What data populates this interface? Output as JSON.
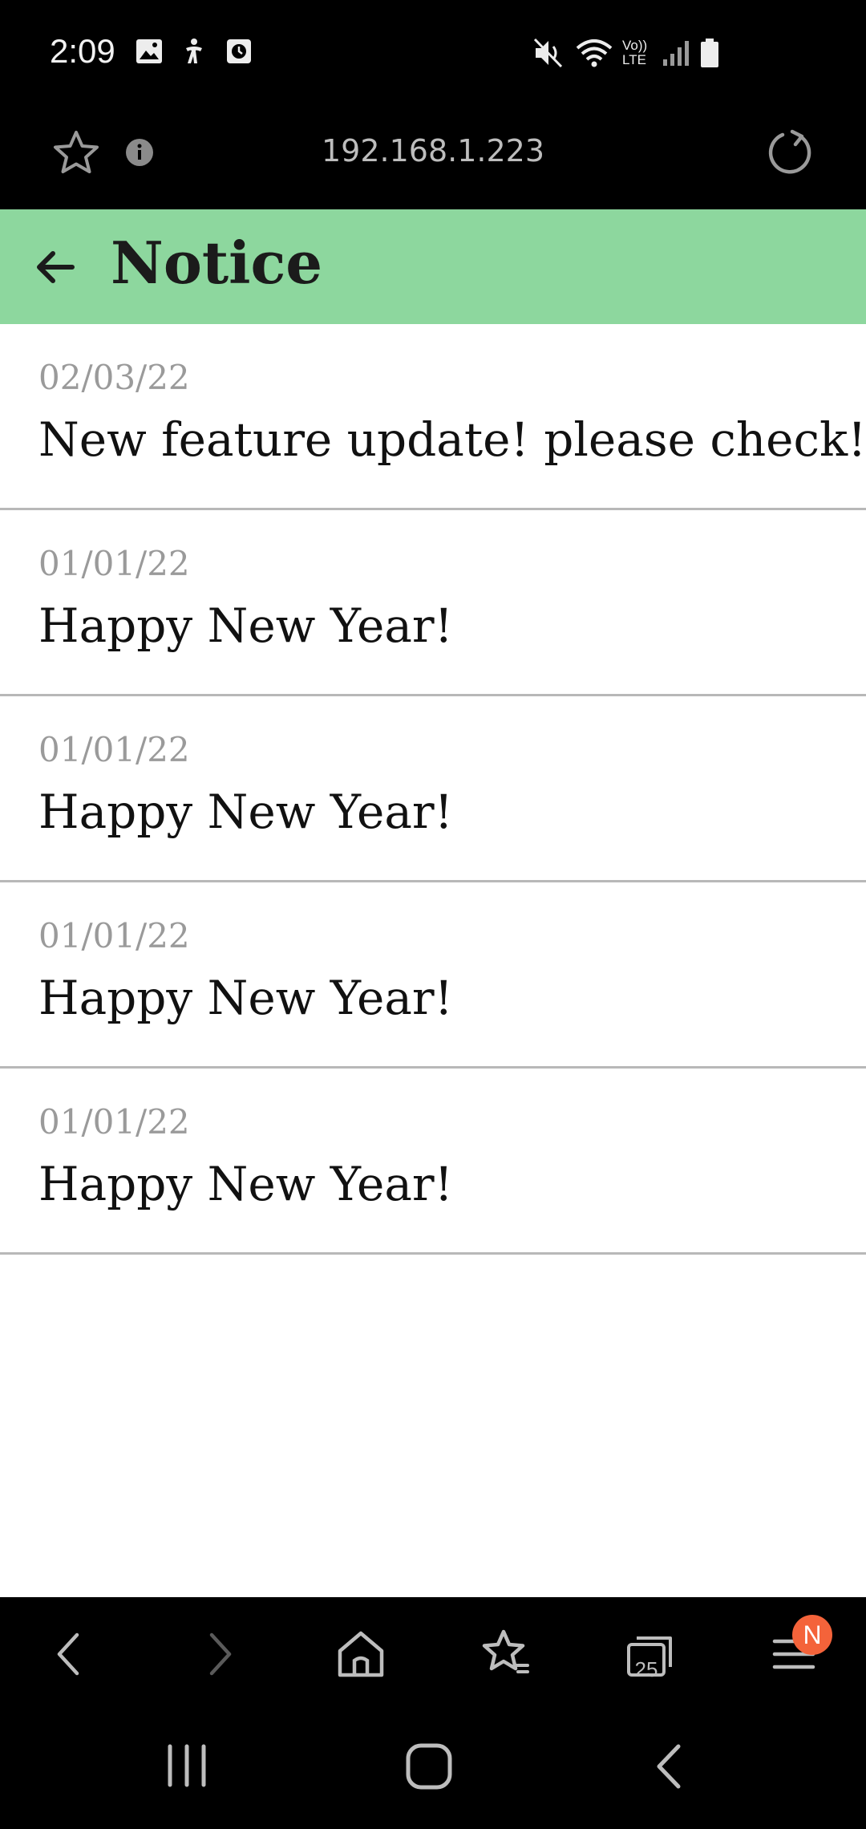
{
  "status_bar": {
    "time": "2:09",
    "left_icons": [
      "image-icon",
      "accessibility-icon",
      "clock-icon"
    ],
    "right_icons": [
      "mute-icon",
      "wifi-icon",
      "volte-icon",
      "signal-icon",
      "battery-icon"
    ],
    "volte_text": "Vo)) LTE"
  },
  "browser": {
    "url": "192.168.1.223",
    "bookmark_icon": "star-icon",
    "info_icon": "info-icon",
    "reload_icon": "reload-icon"
  },
  "header": {
    "title": "Notice",
    "back_icon": "back-arrow-icon",
    "background": "#8dd79e"
  },
  "notices": [
    {
      "date": "02/03/22",
      "title": "New feature update! please check!"
    },
    {
      "date": "01/01/22",
      "title": "Happy New Year!"
    },
    {
      "date": "01/01/22",
      "title": "Happy New Year!"
    },
    {
      "date": "01/01/22",
      "title": "Happy New Year!"
    },
    {
      "date": "01/01/22",
      "title": "Happy New Year!"
    }
  ],
  "toolbar": {
    "tabs_count": "25",
    "menu_badge": "N",
    "badge_color": "#f4633a"
  }
}
